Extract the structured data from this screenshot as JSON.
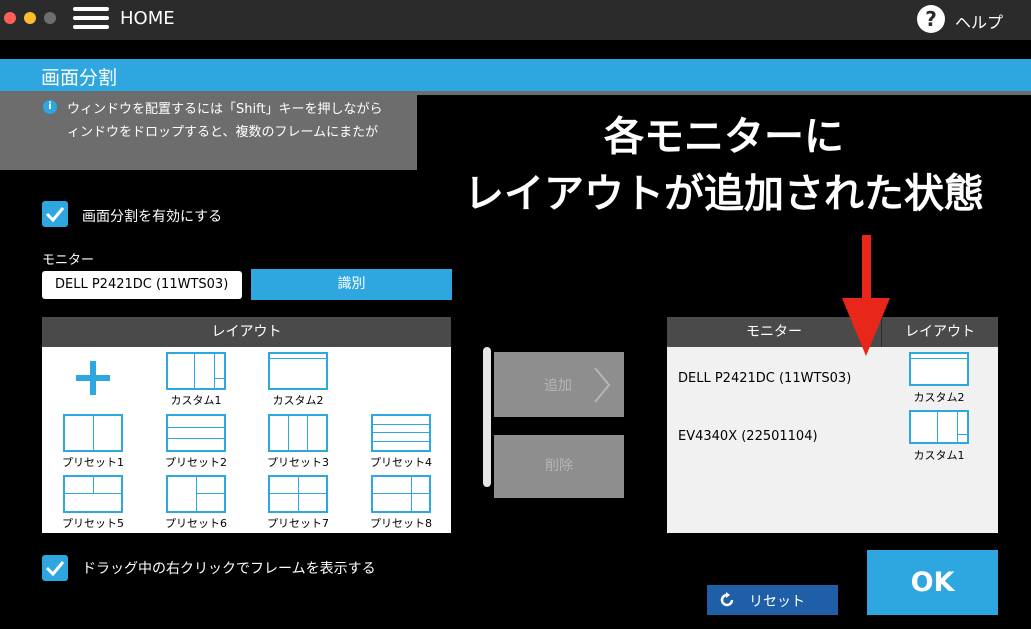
{
  "titlebar": {
    "home_label": "HOME",
    "help_icon_text": "?",
    "help_label": "ヘルプ"
  },
  "header": {
    "title": "画面分割"
  },
  "info": {
    "icon_text": "i",
    "line1": "ウィンドウを配置するには「Shift」キーを押しながら",
    "line2": "ィンドウをドロップすると、複数のフレームにまたが"
  },
  "overlay": {
    "line1": "各モニターに",
    "line2": "レイアウトが追加された状態"
  },
  "enable_split": {
    "label": "画面分割を有効にする",
    "checked": true
  },
  "monitor": {
    "label": "モニター",
    "selected": "DELL P2421DC (11WTS03)",
    "identify_label": "識別"
  },
  "layout_panel": {
    "header": "レイアウト",
    "items": [
      {
        "label": "カスタム1",
        "icon": "custom-1-layout-icon"
      },
      {
        "label": "カスタム2",
        "icon": "custom-2-layout-icon"
      },
      {
        "label": "プリセット1",
        "icon": "preset-1-layout-icon"
      },
      {
        "label": "プリセット2",
        "icon": "preset-2-layout-icon"
      },
      {
        "label": "プリセット3",
        "icon": "preset-3-layout-icon"
      },
      {
        "label": "プリセット4",
        "icon": "preset-4-layout-icon"
      },
      {
        "label": "プリセット5",
        "icon": "preset-5-layout-icon"
      },
      {
        "label": "プリセット6",
        "icon": "preset-6-layout-icon"
      },
      {
        "label": "プリセット7",
        "icon": "preset-7-layout-icon"
      },
      {
        "label": "プリセット8",
        "icon": "preset-8-layout-icon"
      }
    ]
  },
  "actions": {
    "add_label": "追加",
    "delete_label": "削除"
  },
  "assign_panel": {
    "header_monitor": "モニター",
    "header_layout": "レイアウト",
    "rows": [
      {
        "monitor": "DELL P2421DC (11WTS03)",
        "layout": "カスタム2"
      },
      {
        "monitor": "EV4340X (22501104)",
        "layout": "カスタム1"
      }
    ]
  },
  "drag_option": {
    "label": "ドラッグ中の右クリックでフレームを表示する",
    "checked": true
  },
  "reset_label": "リセット",
  "ok_label": "OK",
  "colors": {
    "accent": "#2ea7e0",
    "arrow": "#e8271a",
    "reset": "#1f5fa8"
  }
}
